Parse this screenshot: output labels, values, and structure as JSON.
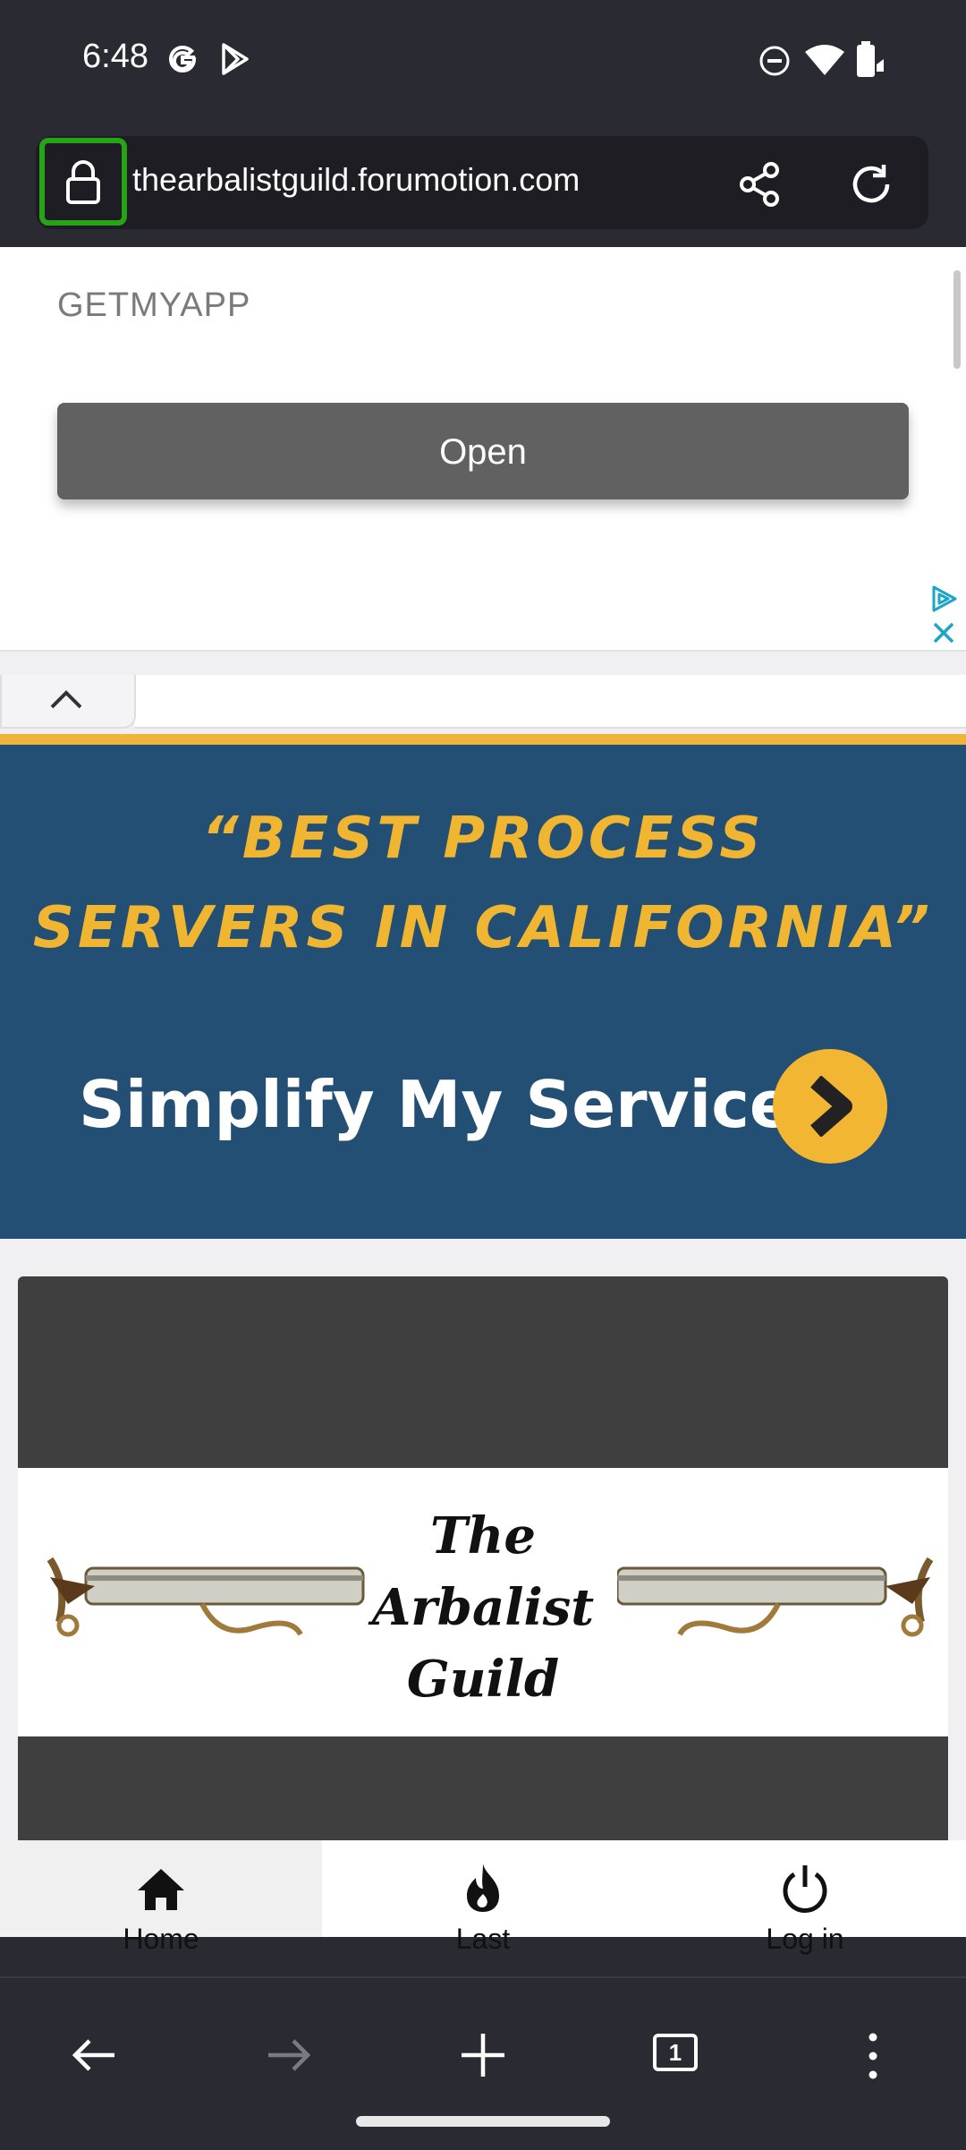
{
  "status_bar": {
    "time": "6:48",
    "left_icons": [
      "google-g-icon",
      "play-store-icon"
    ],
    "right_icons": [
      "do-not-disturb-icon",
      "wifi-icon",
      "battery-charging-icon"
    ]
  },
  "url_bar": {
    "url": "thearbalistguild.forumotion.com",
    "lock_icon": "lock-icon",
    "share_icon": "share-icon",
    "reload_icon": "reload-icon",
    "highlight_color": "#27a317"
  },
  "ad": {
    "advertiser": "GETMYAPP",
    "button_label": "Open",
    "adchoices_icon": "adchoices-icon",
    "close_icon": "close-icon"
  },
  "banner": {
    "line1": "“BEST PROCESS",
    "line2": "SERVERS IN CALIFORNIA”",
    "cta": "Simplify My Service",
    "accent": "#f0b531",
    "background": "#244f74"
  },
  "forum_header": {
    "logo_lines": [
      "The",
      "Arbalist",
      "Guild"
    ]
  },
  "forum_nav": {
    "items": [
      {
        "label": "Home",
        "icon": "home-icon",
        "active": true
      },
      {
        "label": "Last",
        "icon": "flame-icon",
        "active": false
      },
      {
        "label": "Log in",
        "icon": "power-icon",
        "active": false
      }
    ]
  },
  "browser_toolbar": {
    "tab_count": "1",
    "icons": [
      "back-arrow-icon",
      "forward-arrow-icon",
      "new-tab-icon",
      "tab-switcher-icon",
      "more-menu-icon"
    ]
  }
}
